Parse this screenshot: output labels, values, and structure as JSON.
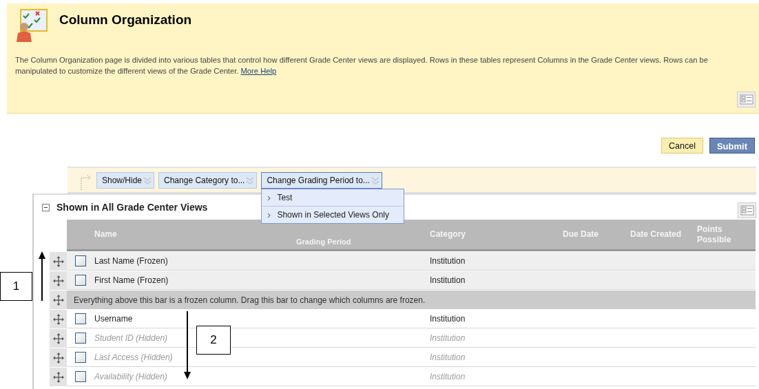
{
  "page": {
    "title": "Column Organization",
    "description": "The Column Organization page is divided into various tables that control how different Grade Center views are displayed. Rows in these tables represent Columns in the Grade Center views. Rows can be manipulated to customize the different views of the Grade Center.",
    "help_link": "More Help"
  },
  "buttons": [
    {
      "label": "Cancel",
      "kind": "secondary"
    },
    {
      "label": "Submit",
      "kind": "primary"
    }
  ],
  "action_bar": {
    "buttons": [
      {
        "label": "Show/Hide",
        "open": false
      },
      {
        "label": "Change Category to...",
        "open": false
      },
      {
        "label": "Change Grading Period to...",
        "open": true
      }
    ],
    "menu": [
      "Test",
      "Shown in Selected Views Only"
    ]
  },
  "section": {
    "title": "Shown in All Grade Center Views",
    "expanded": true,
    "columns": [
      "Name",
      "Grading Period",
      "Category",
      "Due Date",
      "Date Created",
      "Points Possible"
    ],
    "rows": [
      {
        "kind": "column",
        "name": "Last Name (Frozen)",
        "category": "Institution",
        "frozen": true,
        "hidden": false,
        "checked": false
      },
      {
        "kind": "column",
        "name": "First Name (Frozen)",
        "category": "Institution",
        "frozen": true,
        "hidden": false,
        "checked": false
      },
      {
        "kind": "divider",
        "text": "Everything above this bar is a frozen column. Drag this bar to change which columns are frozen."
      },
      {
        "kind": "column",
        "name": "Username",
        "category": "Institution",
        "frozen": false,
        "hidden": false,
        "checked": false
      },
      {
        "kind": "column",
        "name": "Student ID (Hidden)",
        "category": "Institution",
        "frozen": false,
        "hidden": true,
        "checked": false
      },
      {
        "kind": "column",
        "name": "Last Access (Hidden)",
        "category": "Institution",
        "frozen": false,
        "hidden": true,
        "checked": false
      },
      {
        "kind": "column",
        "name": "Availability (Hidden)",
        "category": "Institution",
        "frozen": false,
        "hidden": true,
        "checked": false
      }
    ]
  },
  "callouts": [
    {
      "label": "1",
      "kind": "up"
    },
    {
      "label": "2",
      "kind": "down"
    }
  ]
}
